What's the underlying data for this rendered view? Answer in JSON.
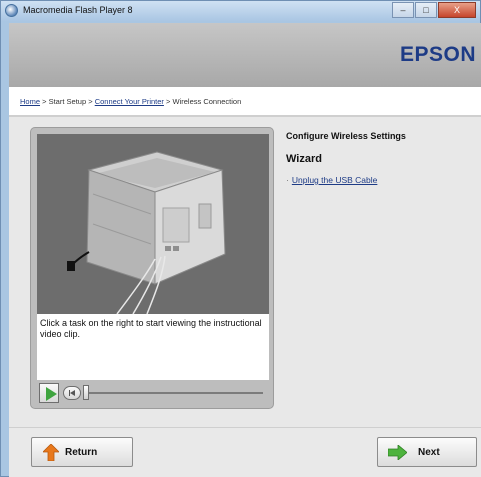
{
  "window": {
    "title": "Macromedia Flash Player 8",
    "buttons": [
      "–",
      "□",
      "X"
    ]
  },
  "brand": {
    "logo": "EPSON",
    "color": "#1d3b86"
  },
  "breadcrumb": {
    "items": [
      "Home",
      "Start Setup",
      "Connect Your Printer",
      "Wireless Connection"
    ],
    "separator": ">"
  },
  "video": {
    "caption": "Click a task on the right to start viewing the instructional video clip.",
    "progress": 0
  },
  "panel": {
    "heading": "Configure Wireless Settings",
    "subheading": "Wizard",
    "tasks": [
      {
        "bullet": "·",
        "label": "Unplug the USB Cable"
      }
    ]
  },
  "footer": {
    "return_label": "Return",
    "next_label": "Next"
  },
  "icons": {
    "app": "flash-player-icon",
    "play": "play-icon",
    "rewind": "rewind-icon",
    "return": "up-arrow-icon",
    "next": "right-arrow-icon"
  }
}
